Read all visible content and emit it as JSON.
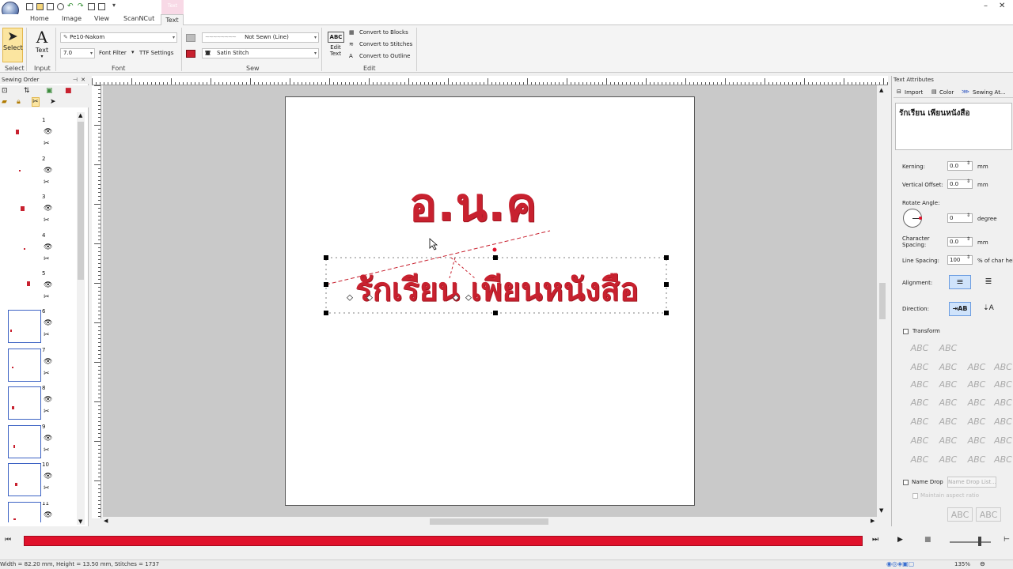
{
  "ribbon_tabs": [
    "Home",
    "Image",
    "View",
    "ScanNCut",
    "Text"
  ],
  "context_tab_label": "Text",
  "ribbon": {
    "select_label": "Select",
    "text_label": "Text",
    "groups": {
      "select": "Select",
      "input": "Input",
      "font": "Font",
      "sew": "Sew",
      "edit": "Edit"
    },
    "font_name": "Pe10-Nakom",
    "font_size": "7.0",
    "font_filter": "Font Filter",
    "ttf_settings": "TTF Settings",
    "line_sew_type": "Not Sewn (Line)",
    "region_sew_type": "Satin Stitch",
    "edit_text_label": "Edit\nText",
    "convert_blocks": "Convert to Blocks",
    "convert_stitches": "Convert to Stitches",
    "convert_outline": "Convert to Outline"
  },
  "left_panel": {
    "title": "Sewing Order",
    "items": [
      {
        "num": "1"
      },
      {
        "num": "2"
      },
      {
        "num": "3"
      },
      {
        "num": "4"
      },
      {
        "num": "5"
      },
      {
        "num": "6"
      },
      {
        "num": "7"
      },
      {
        "num": "8"
      },
      {
        "num": "9"
      },
      {
        "num": "10"
      },
      {
        "num": "11"
      }
    ]
  },
  "canvas": {
    "line1": "อ.น.ค",
    "line2": "รักเรียน เพียนหนังสือ"
  },
  "right_panel": {
    "title": "Text Attributes",
    "tabs": [
      "Import",
      "Color",
      "Sewing At..."
    ],
    "text_value": "รักเรียน เพียนหนังสือ",
    "kerning_label": "Kerning:",
    "kerning_value": "0.0",
    "kerning_unit": "mm",
    "voffset_label": "Vertical Offset:",
    "voffset_value": "0.0",
    "voffset_unit": "mm",
    "rotate_label": "Rotate Angle:",
    "rotate_value": "0",
    "rotate_unit": "degree",
    "charspacing_label": "Character\nSpacing:",
    "charspacing_value": "0.0",
    "charspacing_unit": "mm",
    "linespacing_label": "Line Spacing:",
    "linespacing_value": "100",
    "linespacing_unit": "% of char heig",
    "alignment_label": "Alignment:",
    "direction_label": "Direction:",
    "transform_label": "Transform",
    "namedrop_label": "Name Drop",
    "namedrop_button": "Name Drop List...",
    "maintain_label": "Maintain aspect ratio",
    "abc_sample": "ABC"
  },
  "statusbar": {
    "info": "Width = 82.20 mm, Height = 13.50 mm, Stitches = 1737",
    "zoom": "135%"
  },
  "colors": {
    "accent_red": "#e0112b",
    "stitch_red": "#c8212f",
    "highlight": "#fbe5a0"
  }
}
